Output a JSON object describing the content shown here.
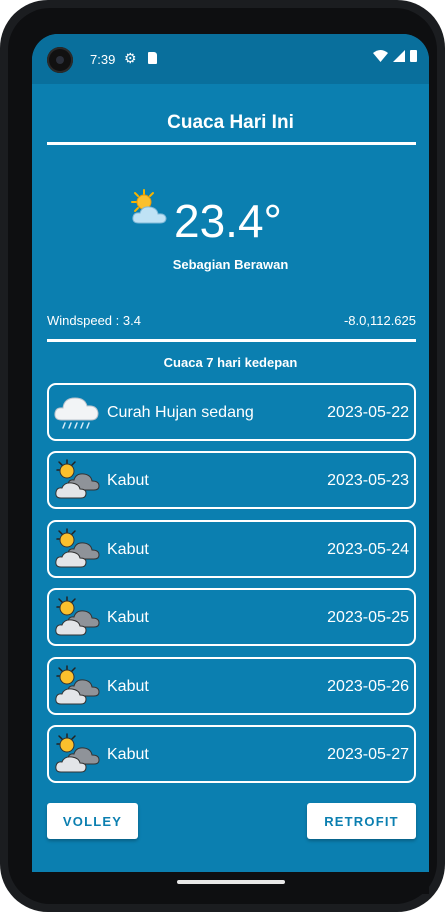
{
  "status_bar": {
    "time": "7:39"
  },
  "header": {
    "title": "Cuaca Hari Ini"
  },
  "current": {
    "temperature": "23.4°",
    "condition": "Sebagian Berawan",
    "icon": "partly-cloudy-icon"
  },
  "info": {
    "windspeed": "Windspeed : 3.4",
    "coordinates": "-8.0,112.625"
  },
  "forecast": {
    "heading": "Cuaca 7 hari kedepan",
    "items": [
      {
        "description": "Curah Hujan sedang",
        "date": "2023-05-22",
        "icon": "rain-cloud-icon"
      },
      {
        "description": "Kabut",
        "date": "2023-05-23",
        "icon": "fog-cloud-icon"
      },
      {
        "description": "Kabut",
        "date": "2023-05-24",
        "icon": "fog-cloud-icon"
      },
      {
        "description": "Kabut",
        "date": "2023-05-25",
        "icon": "fog-cloud-icon"
      },
      {
        "description": "Kabut",
        "date": "2023-05-26",
        "icon": "fog-cloud-icon"
      },
      {
        "description": "Kabut",
        "date": "2023-05-27",
        "icon": "fog-cloud-icon"
      }
    ]
  },
  "buttons": {
    "volley": "VOLLEY",
    "retrofit": "RETROFIT"
  },
  "colors": {
    "background": "#0b7fb0",
    "status_bar": "#096f9c",
    "card_border": "#ffffff",
    "button_text": "#0b7fb0"
  }
}
